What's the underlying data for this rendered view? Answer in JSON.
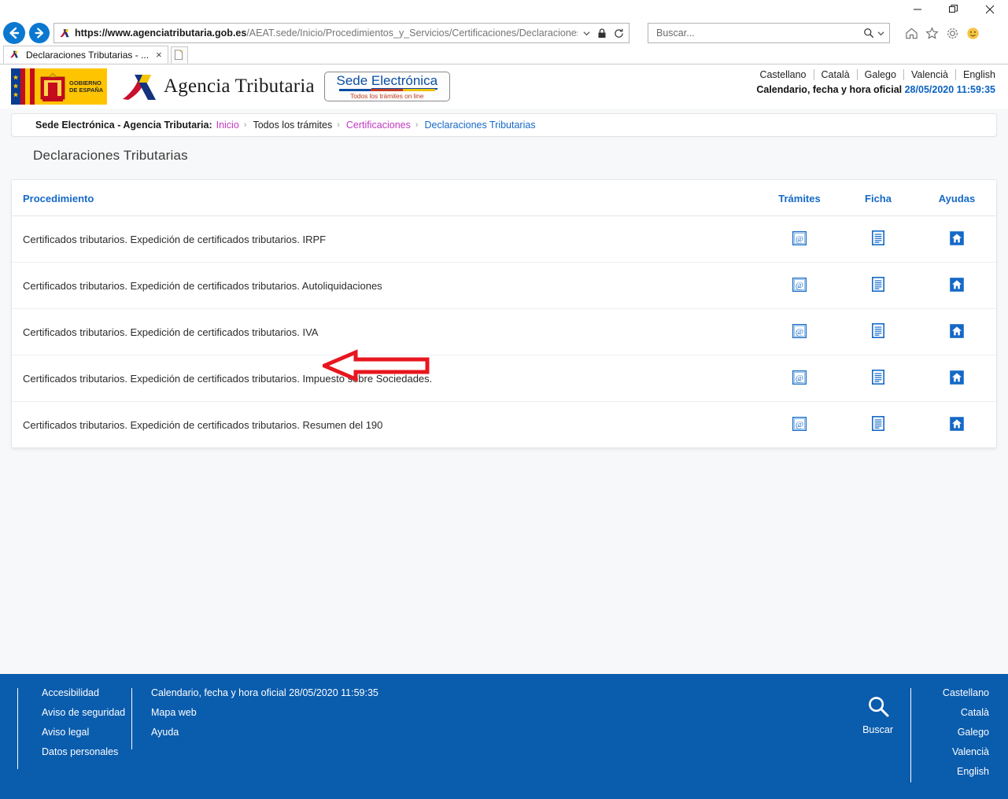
{
  "browser": {
    "window_controls": {
      "minimize": "minimize-icon",
      "maximize": "restore-icon",
      "close": "close-icon"
    },
    "back_label": "back-arrow-icon",
    "forward_label": "forward-arrow-icon",
    "url_scheme": "https://www.",
    "url_host": "agenciatributaria.gob.es",
    "url_path": "/AEAT.sede/Inicio/Procedimientos_y_Servicios/Certificaciones/Declaraciones_Tributarias/Decla",
    "url_full": "https://www.agenciatributaria.gob.es/AEAT.sede/Inicio/Procedimientos_y_Servicios/Certificaciones/Declaraciones_Tributarias/Decla",
    "lock_icon": "lock-icon",
    "refresh_icon": "refresh-icon",
    "dropdown_icon": "chevron-down-icon",
    "search_placeholder": "Buscar...",
    "search_value": "",
    "home_icon": "home-icon",
    "favorites_icon": "star-icon",
    "settings_icon": "gear-icon",
    "smiley_icon": "smiley-feedback-icon",
    "tab_title": "Declaraciones Tributarias - ...",
    "tab_close": "×",
    "new_tab_label": "new-tab-icon"
  },
  "header": {
    "gov_logo_line1": "GOBIERNO",
    "gov_logo_line2": "DE ESPAÑA",
    "agency_name": "Agencia Tributaria",
    "sede_word1": "Sede",
    "sede_word2": "Electrónica",
    "sede_tagline": "Todos los trámites on line",
    "languages": [
      "Castellano",
      "Català",
      "Galego",
      "Valencià",
      "English"
    ],
    "calendar_label": "Calendario, fecha y hora oficial",
    "datetime": "28/05/2020 11:59:35"
  },
  "breadcrumb": {
    "prefix": "Sede Electrónica - Agencia Tributaria:",
    "items": [
      {
        "label": "Inicio",
        "style": "visited"
      },
      {
        "label": "Todos los trámites",
        "style": "plain"
      },
      {
        "label": "Certificaciones",
        "style": "visited"
      },
      {
        "label": "Declaraciones Tributarias",
        "style": "current"
      }
    ],
    "separator": "›"
  },
  "main": {
    "page_title": "Declaraciones Tributarias",
    "table": {
      "columns": [
        "Procedimiento",
        "Trámites",
        "Ficha",
        "Ayudas"
      ],
      "rows": [
        {
          "procedimiento": "Certificados tributarios. Expedición de certificados tributarios. IRPF",
          "tramites_icon": "at-sign-icon",
          "ficha_icon": "document-icon",
          "ayudas_icon": "house-icon"
        },
        {
          "procedimiento": "Certificados tributarios. Expedición de certificados tributarios. Autoliquidaciones",
          "tramites_icon": "at-sign-icon",
          "ficha_icon": "document-icon",
          "ayudas_icon": "house-icon"
        },
        {
          "procedimiento": "Certificados tributarios. Expedición de certificados tributarios. IVA",
          "tramites_icon": "at-sign-icon",
          "ficha_icon": "document-icon",
          "ayudas_icon": "house-icon"
        },
        {
          "procedimiento": "Certificados tributarios. Expedición de certificados tributarios. Impuesto sobre Sociedades.",
          "tramites_icon": "at-sign-icon",
          "ficha_icon": "document-icon",
          "ayudas_icon": "house-icon"
        },
        {
          "procedimiento": "Certificados tributarios. Expedición de certificados tributarios. Resumen del 190",
          "tramites_icon": "at-sign-icon",
          "ficha_icon": "document-icon",
          "ayudas_icon": "house-icon"
        }
      ]
    },
    "annotation": {
      "type": "left-arrow",
      "color": "#e8161f",
      "target_row_index": 2
    }
  },
  "footer": {
    "column1": [
      "Accesibilidad",
      "Aviso de seguridad",
      "Aviso legal",
      "Datos personales"
    ],
    "column2": [
      "Calendario, fecha y hora oficial 28/05/2020 11:59:35",
      "Mapa web",
      "Ayuda"
    ],
    "search_label": "Buscar",
    "search_icon": "search-icon",
    "languages": [
      "Castellano",
      "Català",
      "Galego",
      "Valencià",
      "English"
    ]
  },
  "colors": {
    "accent_blue": "#1569c7",
    "footer_blue": "#0a5cad",
    "visited_link": "#c038c0",
    "annotation_red": "#e8161f",
    "flag_yellow": "#ffc400",
    "flag_red": "#c60b1e"
  }
}
